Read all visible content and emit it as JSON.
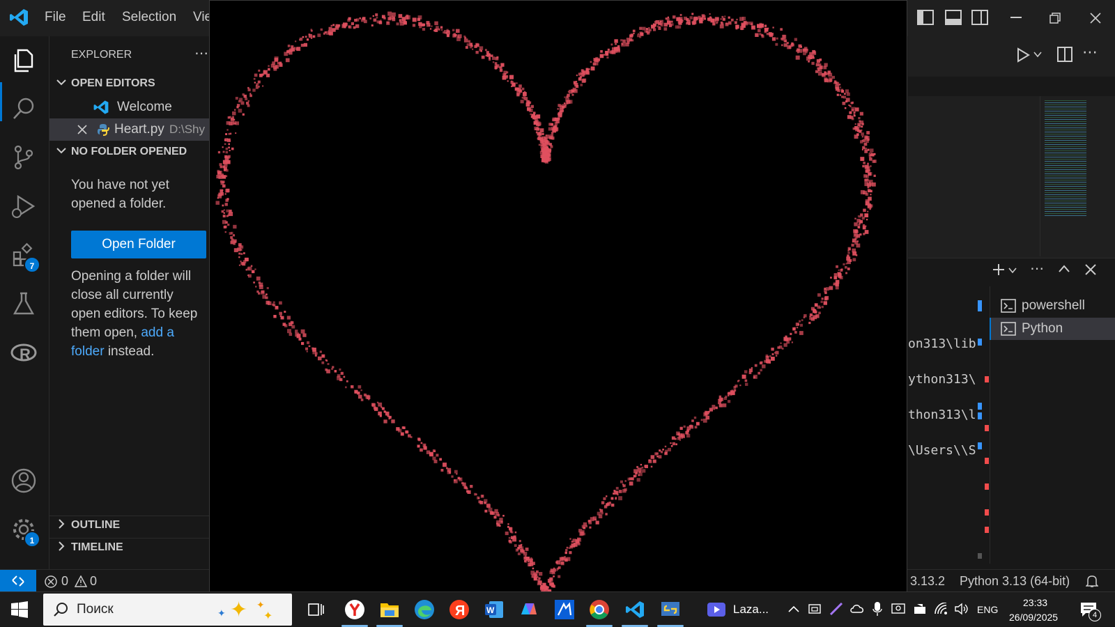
{
  "menu": {
    "file": "File",
    "edit": "Edit",
    "selection": "Selection",
    "view": "Vie"
  },
  "activity": {
    "extensions_badge": "7",
    "settings_badge": "1"
  },
  "sidebar": {
    "title": "EXPLORER",
    "open_editors": "OPEN EDITORS",
    "editors": [
      {
        "name": "Welcome",
        "path": ""
      },
      {
        "name": "Heart.py",
        "path": "D:\\Shy"
      }
    ],
    "no_folder": "NO FOLDER OPENED",
    "no_folder_msg": "You have not yet opened a folder.",
    "open_folder_btn": "Open Folder",
    "open_msg_before": "Opening a folder will close all currently open editors. To keep them open,",
    "open_msg_link": "add a folder",
    "open_msg_after": "instead.",
    "outline": "OUTLINE",
    "timeline": "TIMELINE"
  },
  "terminal": {
    "lines": [
      "on313\\lib",
      "ython313\\",
      "thon313\\l",
      "\\Users\\\\S"
    ],
    "tabs": [
      "powershell",
      "Python"
    ]
  },
  "status": {
    "errors": "0",
    "warnings": "0",
    "version_partial": "3.13.2",
    "interpreter": "Python 3.13 (64-bit)"
  },
  "taskbar": {
    "search_placeholder": "Поиск",
    "running_app": "Laza...",
    "lang": "ENG",
    "time": "23:33",
    "date": "26/09/2025",
    "notif_count": "4"
  },
  "colors": {
    "accent": "#0078d4",
    "heart": "#e0505f",
    "background": "#181818"
  }
}
